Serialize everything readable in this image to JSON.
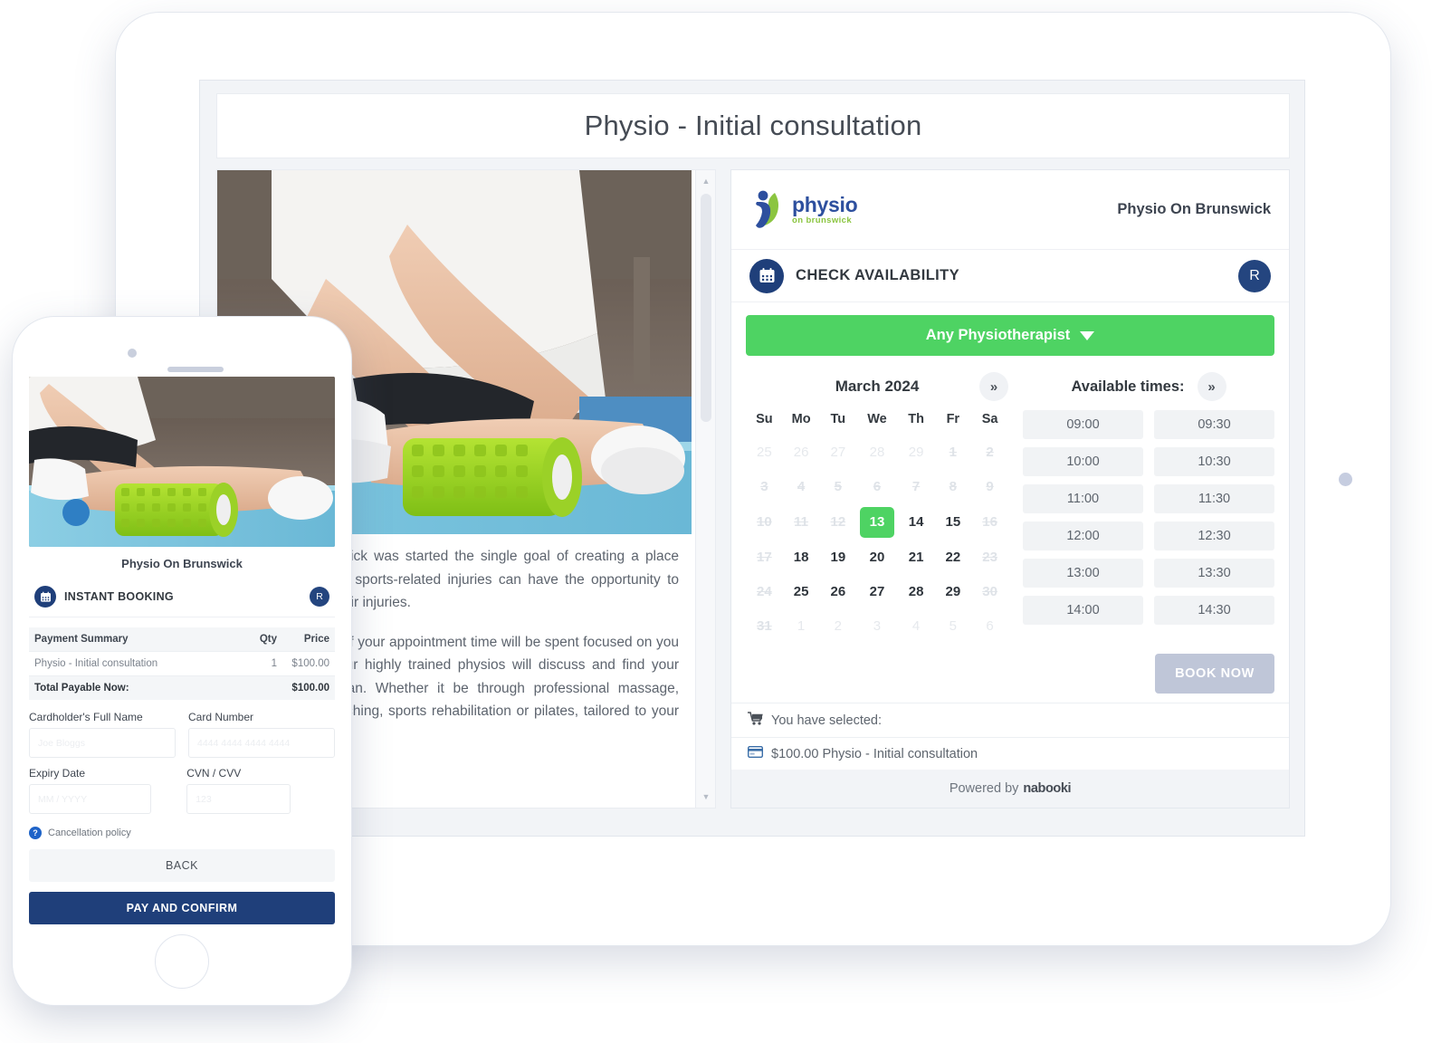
{
  "page": {
    "title": "Physio - Initial consultation"
  },
  "description": {
    "paragraph1": "Physio On Brunswick was started the single goal of creating a place where people with sports-related injuries can have the opportunity to find solutions to their injuries.",
    "paragraph2": "We ensure 100% of your appointment time will be spent focused on you and you alone. Our highly trained physios will discuss and find your ideal treatment plan. Whether it be through professional massage, manipulation, stretching, sports rehabilitation or pilates, tailored to your injury."
  },
  "widget": {
    "logo": {
      "line1": "physio",
      "line2": "on brunswick"
    },
    "brand_name": "Physio On Brunswick",
    "section_title": "CHECK AVAILABILITY",
    "avatar_initial": "R",
    "staff_select": "Any Physiotherapist",
    "calendar": {
      "month_label": "March 2024",
      "next_label": "»",
      "weekdays": [
        "Su",
        "Mo",
        "Tu",
        "We",
        "Th",
        "Fr",
        "Sa"
      ],
      "weeks": [
        [
          {
            "d": "25",
            "s": "out"
          },
          {
            "d": "26",
            "s": "out"
          },
          {
            "d": "27",
            "s": "out"
          },
          {
            "d": "28",
            "s": "out"
          },
          {
            "d": "29",
            "s": "out"
          },
          {
            "d": "1",
            "s": "dis"
          },
          {
            "d": "2",
            "s": "dis"
          }
        ],
        [
          {
            "d": "3",
            "s": "dis"
          },
          {
            "d": "4",
            "s": "dis"
          },
          {
            "d": "5",
            "s": "dis"
          },
          {
            "d": "6",
            "s": "dis"
          },
          {
            "d": "7",
            "s": "dis"
          },
          {
            "d": "8",
            "s": "dis"
          },
          {
            "d": "9",
            "s": "dis"
          }
        ],
        [
          {
            "d": "10",
            "s": "dis"
          },
          {
            "d": "11",
            "s": "dis"
          },
          {
            "d": "12",
            "s": "dis"
          },
          {
            "d": "13",
            "s": "sel"
          },
          {
            "d": "14",
            "s": "on"
          },
          {
            "d": "15",
            "s": "on"
          },
          {
            "d": "16",
            "s": "dis"
          }
        ],
        [
          {
            "d": "17",
            "s": "dis"
          },
          {
            "d": "18",
            "s": "on"
          },
          {
            "d": "19",
            "s": "on"
          },
          {
            "d": "20",
            "s": "on"
          },
          {
            "d": "21",
            "s": "on"
          },
          {
            "d": "22",
            "s": "on"
          },
          {
            "d": "23",
            "s": "dis"
          }
        ],
        [
          {
            "d": "24",
            "s": "dis"
          },
          {
            "d": "25",
            "s": "on"
          },
          {
            "d": "26",
            "s": "on"
          },
          {
            "d": "27",
            "s": "on"
          },
          {
            "d": "28",
            "s": "on"
          },
          {
            "d": "29",
            "s": "on"
          },
          {
            "d": "30",
            "s": "dis"
          }
        ],
        [
          {
            "d": "31",
            "s": "dis"
          },
          {
            "d": "1",
            "s": "out"
          },
          {
            "d": "2",
            "s": "out"
          },
          {
            "d": "3",
            "s": "out"
          },
          {
            "d": "4",
            "s": "out"
          },
          {
            "d": "5",
            "s": "out"
          },
          {
            "d": "6",
            "s": "out"
          }
        ]
      ]
    },
    "times": {
      "heading": "Available times:",
      "next_label": "»",
      "slots": [
        "09:00",
        "09:30",
        "10:00",
        "10:30",
        "11:00",
        "11:30",
        "12:00",
        "12:30",
        "13:00",
        "13:30",
        "14:00",
        "14:30"
      ]
    },
    "book_now_label": "BOOK NOW",
    "selected_heading": "You have selected:",
    "selected_item": "$100.00 Physio - Initial consultation",
    "powered_prefix": "Powered by",
    "powered_brand": "nabooki"
  },
  "phone": {
    "brand_name": "Physio On Brunswick",
    "section_title": "INSTANT BOOKING",
    "avatar_initial": "R",
    "payment_table": {
      "headers": [
        "Payment Summary",
        "Qty",
        "Price"
      ],
      "rows": [
        {
          "item": "Physio - Initial consultation",
          "qty": "1",
          "price": "$100.00"
        }
      ],
      "total_label": "Total Payable Now:",
      "total_value": "$100.00"
    },
    "fields": {
      "cardholder_label": "Cardholder's Full Name",
      "cardholder_placeholder": "Joe Bloggs",
      "cardnumber_label": "Card Number",
      "cardnumber_placeholder": "4444 4444 4444 4444",
      "expiry_label": "Expiry Date",
      "expiry_placeholder": "MM / YYYY",
      "cvv_label": "CVN / CVV",
      "cvv_placeholder": "123"
    },
    "cancellation_policy": "Cancellation policy",
    "back_label": "BACK",
    "pay_label": "PAY AND CONFIRM"
  },
  "colors": {
    "accent_green": "#4ed363",
    "navy": "#1f3f7a",
    "disabled_button": "#bfc6d8"
  }
}
